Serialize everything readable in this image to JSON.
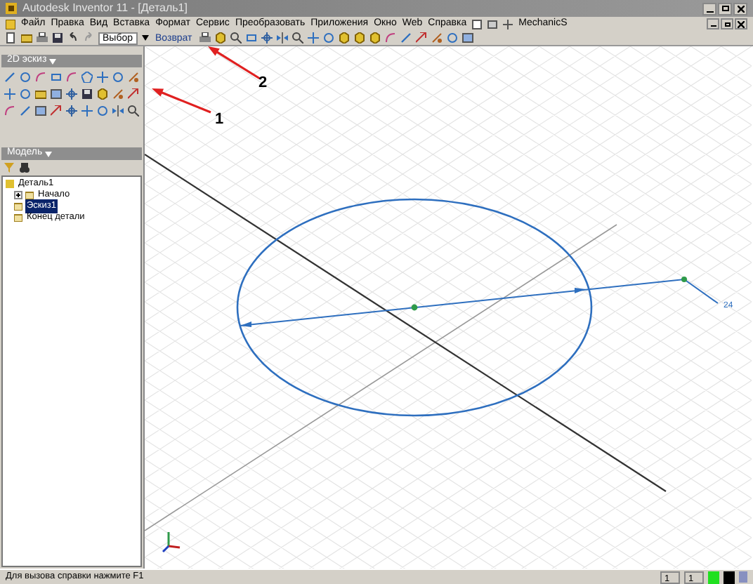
{
  "window": {
    "title": "Autodesk Inventor 11 - [Деталь1]"
  },
  "menu": [
    "Файл",
    "Правка",
    "Вид",
    "Вставка",
    "Формат",
    "Сервис",
    "Преобразовать",
    "Приложения",
    "Окно",
    "Web",
    "Справка"
  ],
  "menu_extra": "MechanicS",
  "toolbar": {
    "select": "Выбор",
    "return_button": "Возврат"
  },
  "sketch_panel": {
    "title": "2D эскиз"
  },
  "model_panel": {
    "title": "Модель",
    "tree": [
      {
        "label": "Деталь1",
        "selected": false,
        "children": [
          {
            "label": "Начало",
            "selected": false,
            "expanded": false
          },
          {
            "label": "Эскиз1",
            "selected": true
          },
          {
            "label": "Конец детали",
            "selected": false
          }
        ]
      }
    ]
  },
  "canvas": {
    "dimension": "24"
  },
  "annotations": [
    {
      "label": "1"
    },
    {
      "label": "2"
    }
  ],
  "status_bar": {
    "hint": "Для вызова справки нажмите F1",
    "field_1": "1",
    "field_2": "1"
  }
}
